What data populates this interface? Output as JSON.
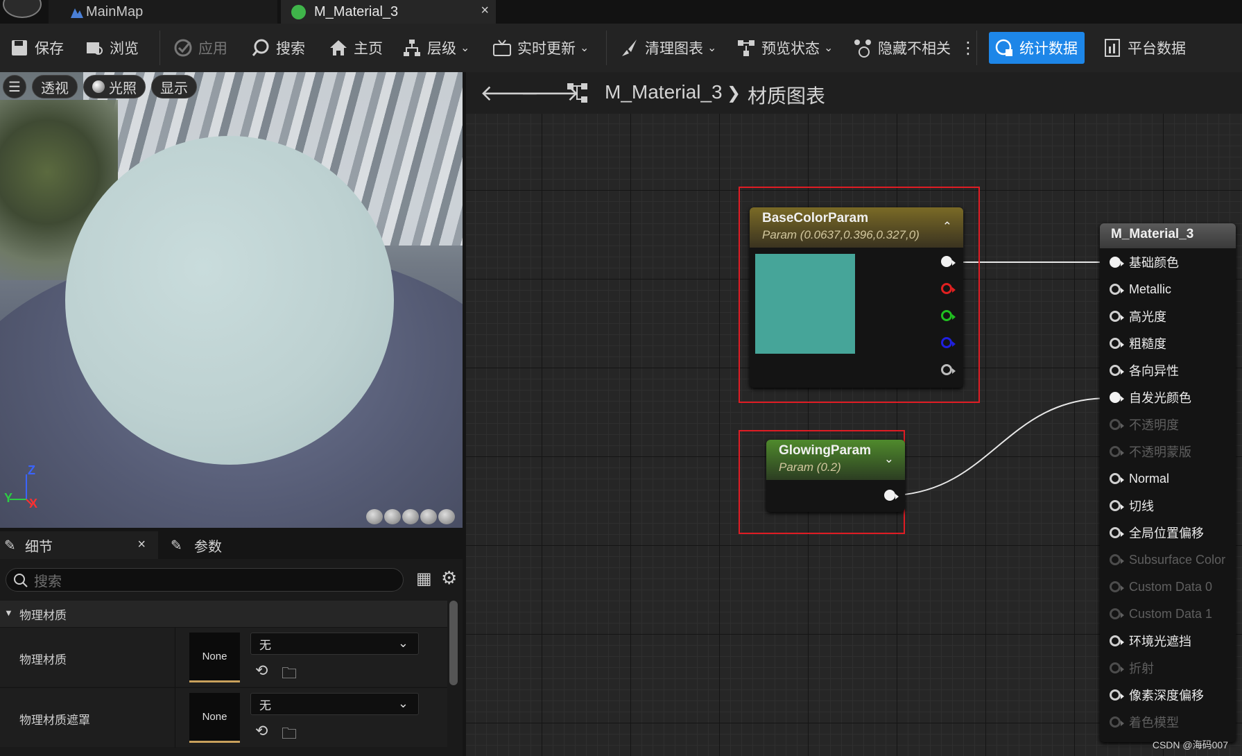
{
  "tabs": [
    {
      "label": "MainMap",
      "icon": "map-icon"
    },
    {
      "label": "M_Material_3",
      "icon": "material-icon",
      "close": "×"
    }
  ],
  "toolbar": {
    "save": "保存",
    "browse": "浏览",
    "apply": "应用",
    "search": "搜索",
    "home": "主页",
    "hierarchy": "层级",
    "live_update": "实时更新",
    "clean_graph": "清理图表",
    "preview_state": "预览状态",
    "hide_unrelated": "隐藏不相关",
    "stats": "统计数据",
    "platform_stats": "平台数据"
  },
  "viewport": {
    "buttons": {
      "perspective": "透视",
      "lighting": "光照",
      "show": "显示"
    },
    "axes": {
      "z": "Z",
      "y": "Y",
      "x": "X"
    }
  },
  "details": {
    "tab_details": "细节",
    "tab_params": "参数",
    "close": "×",
    "search_placeholder": "搜索",
    "category": "物理材质",
    "rows": [
      {
        "label": "物理材质",
        "thumb": "None",
        "value": "无"
      },
      {
        "label": "物理材质遮罩",
        "thumb": "None",
        "value": "无"
      }
    ]
  },
  "graph": {
    "breadcrumb_root": "M_Material_3",
    "breadcrumb_sep": "❯",
    "breadcrumb_child": "材质图表",
    "base_color_node": {
      "title": "BaseColorParam",
      "subtitle": "Param (0.0637,0.396,0.327,0)",
      "swatch": "#46a599",
      "collapse": "⌃"
    },
    "glowing_node": {
      "title": "GlowingParam",
      "subtitle": "Param (0.2)",
      "collapse": "⌄"
    },
    "material_node": {
      "title": "M_Material_3",
      "pins": [
        {
          "label": "基础颜色",
          "connected": true
        },
        {
          "label": "Metallic",
          "connected": false
        },
        {
          "label": "高光度",
          "connected": false
        },
        {
          "label": "粗糙度",
          "connected": false
        },
        {
          "label": "各向异性",
          "connected": false
        },
        {
          "label": "自发光颜色",
          "connected": true
        },
        {
          "label": "不透明度",
          "dim": true
        },
        {
          "label": "不透明蒙版",
          "dim": true
        },
        {
          "label": "Normal",
          "connected": false
        },
        {
          "label": "切线",
          "connected": false
        },
        {
          "label": "全局位置偏移",
          "connected": false
        },
        {
          "label": "Subsurface Color",
          "dim": true
        },
        {
          "label": "Custom Data 0",
          "dim": true
        },
        {
          "label": "Custom Data 1",
          "dim": true
        },
        {
          "label": "环境光遮挡",
          "connected": false
        },
        {
          "label": "折射",
          "dim": true
        },
        {
          "label": "像素深度偏移",
          "connected": false
        },
        {
          "label": "着色模型",
          "dim": true
        }
      ]
    }
  },
  "watermark": "CSDN @海码007",
  "colors": {
    "accent": "#1d86e8",
    "selection": "#e01c24"
  }
}
